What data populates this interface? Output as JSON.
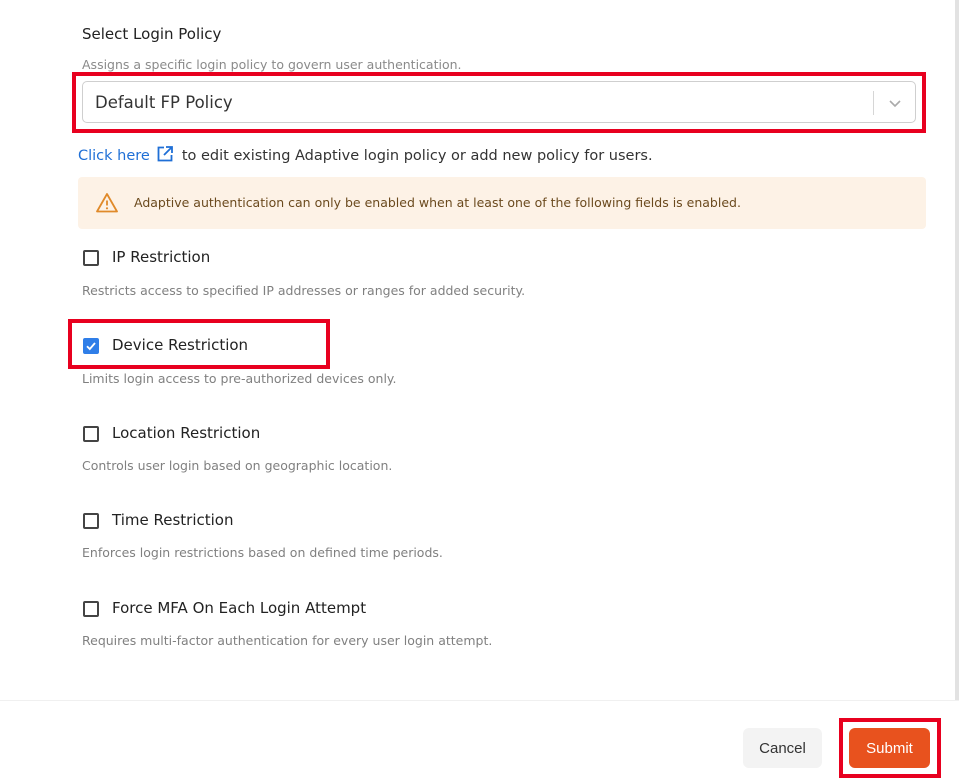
{
  "policy": {
    "title": "Select Login Policy",
    "description": "Assigns a specific login policy to govern user authentication.",
    "selected": "Default FP Policy"
  },
  "link_row": {
    "link_text": "Click here",
    "rest_text": "to edit existing Adaptive login policy or add new policy for users."
  },
  "alert": {
    "text": "Adaptive authentication can only be enabled when at least one of the following fields is enabled.",
    "icon": "warning-icon"
  },
  "options": [
    {
      "label": "IP Restriction",
      "description": "Restricts access to specified IP addresses or ranges for added security.",
      "checked": false
    },
    {
      "label": "Device Restriction",
      "description": "Limits login access to pre-authorized devices only.",
      "checked": true
    },
    {
      "label": "Location Restriction",
      "description": "Controls user login based on geographic location.",
      "checked": false
    },
    {
      "label": "Time Restriction",
      "description": "Enforces login restrictions based on defined time periods.",
      "checked": false
    },
    {
      "label": "Force MFA On Each Login Attempt",
      "description": "Requires multi-factor authentication for every user login attempt.",
      "checked": false
    }
  ],
  "footer": {
    "cancel_label": "Cancel",
    "submit_label": "Submit"
  },
  "colors": {
    "link": "#1f6fd6",
    "checkbox_checked": "#2f7ee8",
    "submit": "#e8521e",
    "alert_bg": "#fdf2e6",
    "highlight": "#e8001f"
  }
}
